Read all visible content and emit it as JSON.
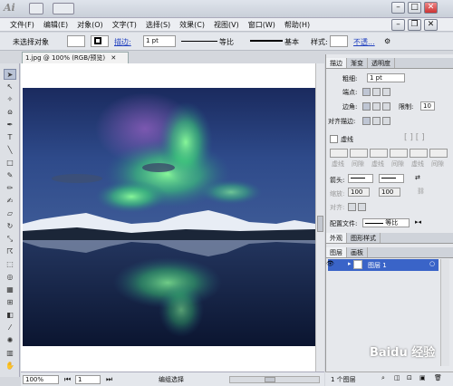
{
  "titlebar": {
    "app_icon": "Ai"
  },
  "menu": [
    "文件(F)",
    "编辑(E)",
    "对象(O)",
    "文字(T)",
    "选择(S)",
    "效果(C)",
    "视图(V)",
    "窗口(W)",
    "帮助(H)"
  ],
  "control": {
    "no_selection": "未选择对象",
    "stroke_link": "描边:",
    "stroke_weight": "1 pt",
    "profile": "等比",
    "brush": "基本",
    "style_label": "样式:",
    "opacity_link": "不透..."
  },
  "document": {
    "tab_label": "1.jpg @ 100% (RGB/预览)"
  },
  "status": {
    "zoom": "100%",
    "page": "1",
    "mode": "编组选择"
  },
  "stroke_panel": {
    "tabs": [
      "描边",
      "渐变",
      "透明度"
    ],
    "weight_label": "粗细:",
    "weight_value": "1 pt",
    "cap_label": "端点:",
    "corner_label": "边角:",
    "limit_label": "限制:",
    "limit_value": "10",
    "align_label": "对齐描边:",
    "dashed_label": "虚线",
    "dash_labels": [
      "虚线",
      "间隙",
      "虚线",
      "间隙",
      "虚线",
      "间隙"
    ],
    "arrow_label": "箭头:",
    "scale_label": "缩放:",
    "scale_1": "100",
    "scale_2": "100",
    "align_arrow_label": "对齐:",
    "profile_label": "配置文件:",
    "profile_value": "等比"
  },
  "appearance_tabs": [
    "外观",
    "图形样式"
  ],
  "layers_panel": {
    "tabs": [
      "图层",
      "画板"
    ],
    "layer_name": "图层 1",
    "count": "1 个图层"
  },
  "watermark": "Baidu 经验"
}
